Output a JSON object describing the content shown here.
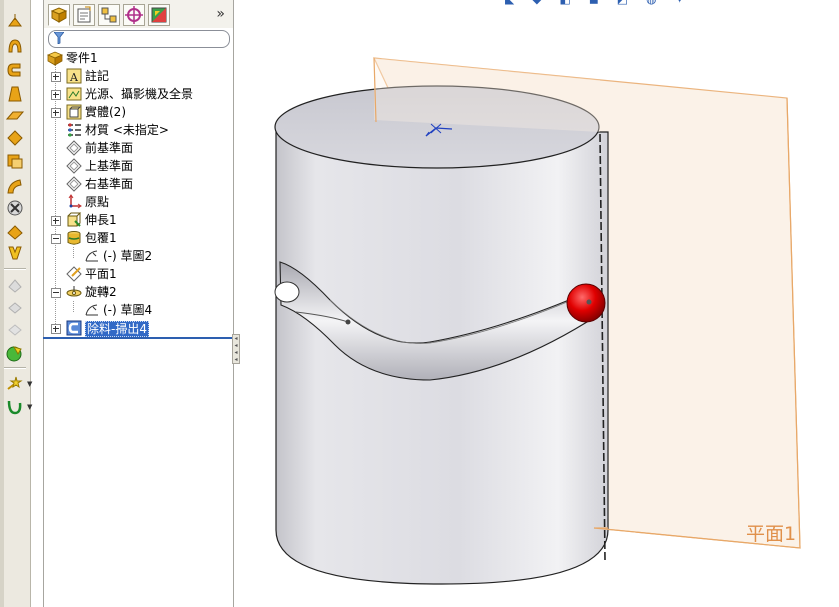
{
  "feature_tree": {
    "root": {
      "label": "零件1",
      "icon": "part-icon"
    },
    "items": [
      {
        "label": "註記",
        "icon": "annotations-icon",
        "expander": "plus"
      },
      {
        "label": "光源、攝影機及全景",
        "icon": "lights-cameras-icon",
        "expander": "plus"
      },
      {
        "label": "實體(2)",
        "icon": "solid-bodies-icon",
        "expander": "plus"
      },
      {
        "label": "材質 <未指定>",
        "icon": "material-icon",
        "expander": ""
      },
      {
        "label": "前基準面",
        "icon": "plane-icon",
        "expander": ""
      },
      {
        "label": "上基準面",
        "icon": "plane-icon",
        "expander": ""
      },
      {
        "label": "右基準面",
        "icon": "plane-icon",
        "expander": ""
      },
      {
        "label": "原點",
        "icon": "origin-icon",
        "expander": ""
      },
      {
        "label": "伸長1",
        "icon": "extrude-icon",
        "expander": "plus"
      },
      {
        "label": "包覆1",
        "icon": "wrap-icon",
        "expander": "minus"
      },
      {
        "label": "(-) 草圖2",
        "icon": "sketch-icon",
        "expander": "",
        "child": true
      },
      {
        "label": "平面1",
        "icon": "plane-icon",
        "expander": ""
      },
      {
        "label": "旋轉2",
        "icon": "revolve-icon",
        "expander": "minus"
      },
      {
        "label": "(-) 草圖4",
        "icon": "sketch-icon",
        "expander": "",
        "child": true
      },
      {
        "label": "除料-掃出4",
        "icon": "swept-cut-icon",
        "expander": "plus",
        "selected": true
      }
    ]
  },
  "panel_tabs": [
    "feature-manager-tab",
    "property-manager-tab",
    "configuration-manager-tab",
    "dimxpert-manager-tab",
    "display-manager-tab"
  ],
  "panel_more": "»",
  "viewport": {
    "plane_label": "平面1"
  },
  "colors": {
    "selection": "#3169c6",
    "plane_outline": "#e0904a",
    "sphere": "#e00000",
    "cylinder": "#e2e2e8"
  }
}
